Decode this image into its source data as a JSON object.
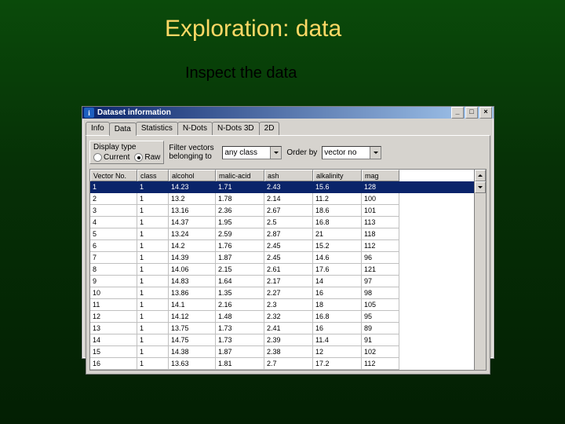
{
  "slide": {
    "title": "Exploration: data",
    "subtitle": "Inspect the data"
  },
  "window": {
    "title": "Dataset information",
    "buttons": {
      "min": "_",
      "max": "□",
      "close": "×"
    }
  },
  "tabs": [
    "Info",
    "Data",
    "Statistics",
    "N-Dots",
    "N-Dots 3D",
    "2D"
  ],
  "active_tab": "Data",
  "display_type": {
    "label": "Display type",
    "options": [
      "Current",
      "Raw"
    ],
    "selected": "Raw"
  },
  "filter": {
    "label": "Filter vectors belonging to",
    "value": "any class"
  },
  "order": {
    "label": "Order by",
    "value": "vector no"
  },
  "columns": [
    "Vector No.",
    "class",
    "alcohol",
    "malic-acid",
    "ash",
    "alkalinity",
    "mag"
  ],
  "rows": [
    {
      "no": "1",
      "class": "1",
      "alcohol": "14.23",
      "malic": "1.71",
      "ash": "2.43",
      "alk": "15.6",
      "mag": "128",
      "sel": true
    },
    {
      "no": "2",
      "class": "1",
      "alcohol": "13.2",
      "malic": "1.78",
      "ash": "2.14",
      "alk": "11.2",
      "mag": "100"
    },
    {
      "no": "3",
      "class": "1",
      "alcohol": "13.16",
      "malic": "2.36",
      "ash": "2.67",
      "alk": "18.6",
      "mag": "101"
    },
    {
      "no": "4",
      "class": "1",
      "alcohol": "14.37",
      "malic": "1.95",
      "ash": "2.5",
      "alk": "16.8",
      "mag": "113"
    },
    {
      "no": "5",
      "class": "1",
      "alcohol": "13.24",
      "malic": "2.59",
      "ash": "2.87",
      "alk": "21",
      "mag": "118"
    },
    {
      "no": "6",
      "class": "1",
      "alcohol": "14.2",
      "malic": "1.76",
      "ash": "2.45",
      "alk": "15.2",
      "mag": "112"
    },
    {
      "no": "7",
      "class": "1",
      "alcohol": "14.39",
      "malic": "1.87",
      "ash": "2.45",
      "alk": "14.6",
      "mag": "96"
    },
    {
      "no": "8",
      "class": "1",
      "alcohol": "14.06",
      "malic": "2.15",
      "ash": "2.61",
      "alk": "17.6",
      "mag": "121"
    },
    {
      "no": "9",
      "class": "1",
      "alcohol": "14.83",
      "malic": "1.64",
      "ash": "2.17",
      "alk": "14",
      "mag": "97"
    },
    {
      "no": "10",
      "class": "1",
      "alcohol": "13.86",
      "malic": "1.35",
      "ash": "2.27",
      "alk": "16",
      "mag": "98"
    },
    {
      "no": "11",
      "class": "1",
      "alcohol": "14.1",
      "malic": "2.16",
      "ash": "2.3",
      "alk": "18",
      "mag": "105"
    },
    {
      "no": "12",
      "class": "1",
      "alcohol": "14.12",
      "malic": "1.48",
      "ash": "2.32",
      "alk": "16.8",
      "mag": "95"
    },
    {
      "no": "13",
      "class": "1",
      "alcohol": "13.75",
      "malic": "1.73",
      "ash": "2.41",
      "alk": "16",
      "mag": "89"
    },
    {
      "no": "14",
      "class": "1",
      "alcohol": "14.75",
      "malic": "1.73",
      "ash": "2.39",
      "alk": "11.4",
      "mag": "91"
    },
    {
      "no": "15",
      "class": "1",
      "alcohol": "14.38",
      "malic": "1.87",
      "ash": "2.38",
      "alk": "12",
      "mag": "102"
    },
    {
      "no": "16",
      "class": "1",
      "alcohol": "13.63",
      "malic": "1.81",
      "ash": "2.7",
      "alk": "17.2",
      "mag": "112"
    }
  ]
}
